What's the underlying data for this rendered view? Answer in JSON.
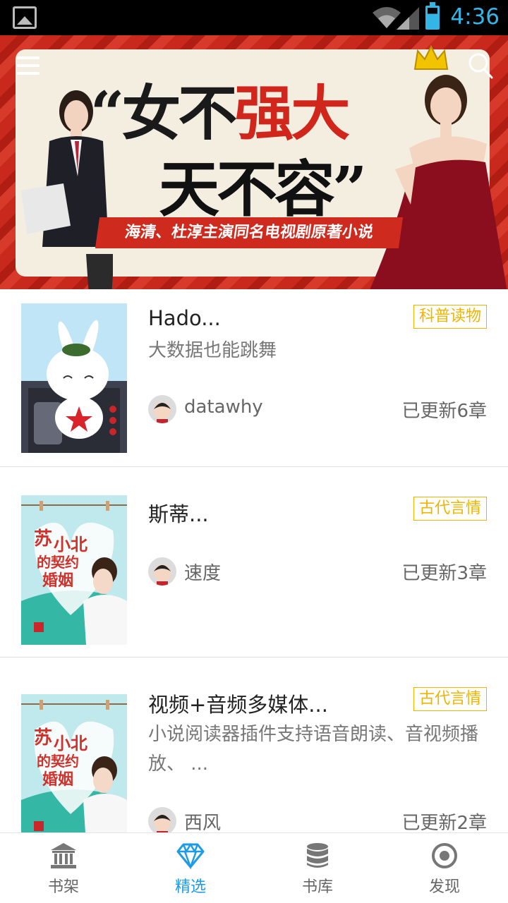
{
  "status_bar": {
    "time": "4:36"
  },
  "banner": {
    "slogan_line1_a": "“女不",
    "slogan_line1_b": "强大",
    "slogan_line2": "天不容”",
    "subtitle": "海清、杜淳主演同名电视剧原著小说"
  },
  "books": [
    {
      "title": "Hado...",
      "description": "大数据也能跳舞",
      "category": "科普读物",
      "author": "datawhy",
      "updates": "已更新6章"
    },
    {
      "title": "斯蒂...",
      "description": "",
      "category": "古代言情",
      "author": "速度",
      "updates": "已更新3章"
    },
    {
      "title": "视频+音频多媒体...",
      "description": "小说阅读器插件支持语音朗读、音视频播放、 ...",
      "category": "古代言情",
      "author": "西风",
      "updates": "已更新2章"
    }
  ],
  "bottom_nav": [
    {
      "label": "书架",
      "icon": "bank-icon"
    },
    {
      "label": "精选",
      "icon": "diamond-icon",
      "active": true
    },
    {
      "label": "书库",
      "icon": "database-icon"
    },
    {
      "label": "发现",
      "icon": "target-icon"
    }
  ],
  "colors": {
    "accent": "#1e9be6",
    "tag": "#f0b400",
    "status_bar_icons": "#33b5e5"
  }
}
